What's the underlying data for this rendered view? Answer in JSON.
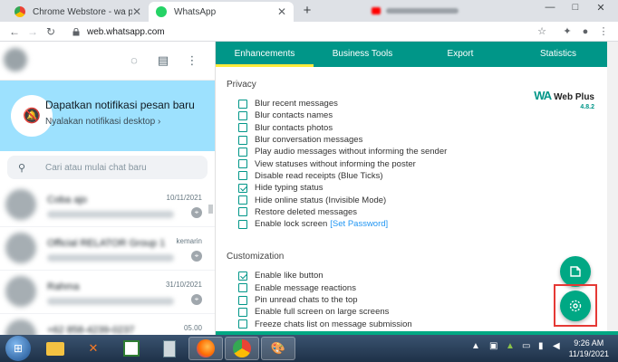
{
  "browser": {
    "tabs": [
      {
        "title": "Chrome Webstore - wa plus",
        "favicon_color": "#ea4335"
      },
      {
        "title": "WhatsApp",
        "favicon_color": "#25d366"
      }
    ],
    "new_tab_label": "+",
    "url": "web.whatsapp.com",
    "window_controls": {
      "minimize": "—",
      "maximize": "□",
      "close": "✕"
    }
  },
  "whatsapp": {
    "notification": {
      "title": "Dapatkan notifikasi pesan baru",
      "subtitle": "Nyalakan notifikasi desktop ›"
    },
    "search": {
      "placeholder": "Cari atau mulai chat baru"
    },
    "chats": [
      {
        "name": "Coba ajo",
        "time": "10/11/2021"
      },
      {
        "name": "Official RELATOR Group 1",
        "time": "kemarin"
      },
      {
        "name": "Rahma",
        "time": "31/10/2021"
      },
      {
        "name": "+62 858-4239-0237",
        "time": "05.00"
      }
    ]
  },
  "wa_plus": {
    "tabs": [
      "Enhancements",
      "Business Tools",
      "Export",
      "Statistics"
    ],
    "active_tab": 0,
    "logo": {
      "mark": "WA",
      "name": "Web Plus",
      "version": "4.8.2"
    },
    "privacy": {
      "title": "Privacy",
      "options": [
        {
          "label": "Blur recent messages",
          "checked": false
        },
        {
          "label": "Blur contacts names",
          "checked": false
        },
        {
          "label": "Blur contacts photos",
          "checked": false
        },
        {
          "label": "Blur conversation messages",
          "checked": false
        },
        {
          "label": "Play audio messages without informing the sender",
          "checked": false
        },
        {
          "label": "View statuses without informing the poster",
          "checked": false
        },
        {
          "label": "Disable read receipts (Blue Ticks)",
          "checked": false
        },
        {
          "label": "Hide typing status",
          "checked": true
        },
        {
          "label": "Hide online status (Invisible Mode)",
          "checked": false
        },
        {
          "label": "Restore deleted messages",
          "checked": false
        },
        {
          "label": "Enable lock screen",
          "checked": false,
          "link": "[Set Password]"
        }
      ]
    },
    "customization": {
      "title": "Customization",
      "options": [
        {
          "label": "Enable like button",
          "checked": true
        },
        {
          "label": "Enable message reactions",
          "checked": false
        },
        {
          "label": "Pin unread chats to the top",
          "checked": false
        },
        {
          "label": "Enable full screen on large screens",
          "checked": false
        },
        {
          "label": "Freeze chats list on message submission",
          "checked": false
        }
      ]
    }
  },
  "taskbar": {
    "time": "9:26 AM",
    "date": "11/19/2021"
  },
  "colors": {
    "wa_plus_teal": "#009688",
    "active_tab_indicator": "#ffeb3b",
    "notification_bg": "#9de1fe",
    "fab": "#00a884",
    "focus_box": "#e53935"
  }
}
